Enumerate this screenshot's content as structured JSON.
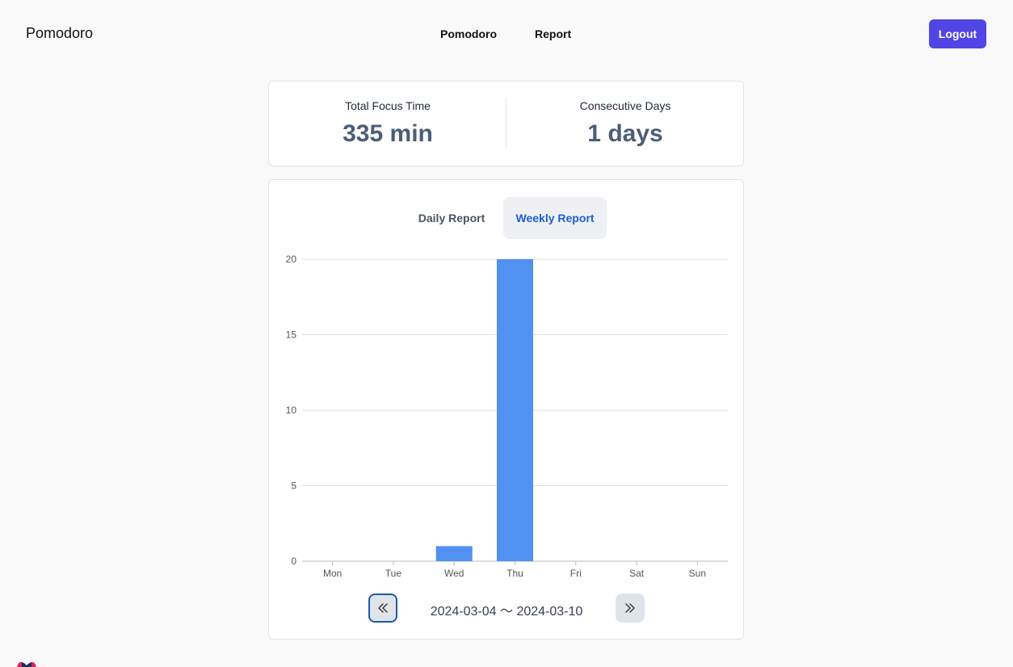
{
  "header": {
    "brand": "Pomodoro",
    "nav": [
      "Pomodoro",
      "Report"
    ],
    "logout_label": "Logout"
  },
  "stats": {
    "total_focus_label": "Total Focus Time",
    "total_focus_value": "335 min",
    "consecutive_label": "Consecutive Days",
    "consecutive_value": "1 days"
  },
  "tabs": {
    "daily": "Daily Report",
    "weekly": "Weekly Report",
    "active": "weekly"
  },
  "chart_data": {
    "type": "bar",
    "categories": [
      "Mon",
      "Tue",
      "Wed",
      "Thu",
      "Fri",
      "Sat",
      "Sun"
    ],
    "values": [
      0,
      0,
      1,
      20,
      0,
      0,
      0
    ],
    "ylim": [
      0,
      20
    ],
    "yticks": [
      0,
      5,
      10,
      15,
      20
    ],
    "grid": true,
    "bar_color": "#5091f2"
  },
  "pager": {
    "range": "2024-03-04 〜 2024-03-10"
  },
  "colors": {
    "accent": "#4f46e5",
    "active_tab_text": "#1d5fd1",
    "stat_value": "#4b5e75"
  }
}
